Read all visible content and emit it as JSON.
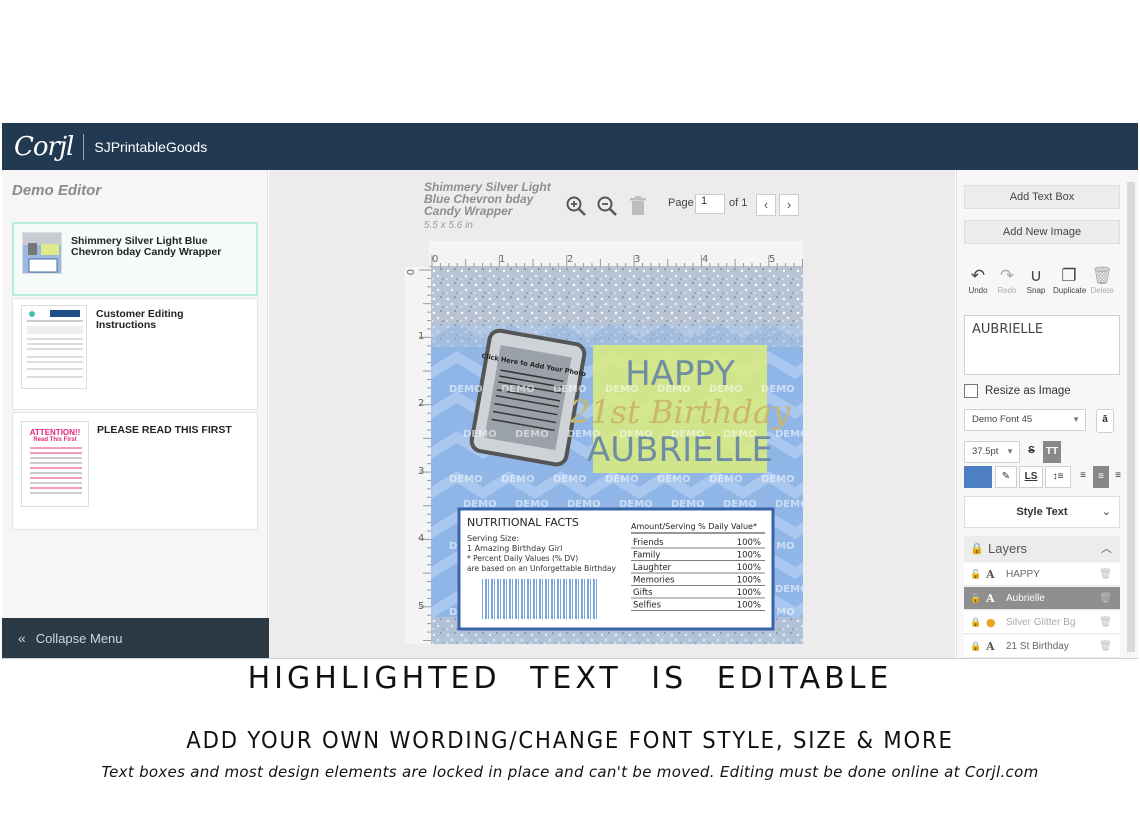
{
  "topbar": {
    "logo": "Corjl",
    "shop_name": "SJPrintableGoods"
  },
  "left_panel": {
    "title": "Demo Editor",
    "items": [
      {
        "label": "Shimmery Silver Light Blue Chevron bday Candy Wrapper",
        "active": true
      },
      {
        "label": "Customer Editing Instructions",
        "active": false
      },
      {
        "label": "PLEASE READ THIS FIRST",
        "active": false,
        "thumb_heading": "ATTENTION!!",
        "thumb_sub": "Read This First"
      }
    ],
    "collapse_label": "Collapse Menu"
  },
  "document": {
    "title": "Shimmery Silver Light Blue Chevron bday Candy Wrapper",
    "size": "5.5 x 5.6 in",
    "page_label": "Page",
    "page_value": "1",
    "of_label": "of 1",
    "ruler_top": [
      "0",
      "1",
      "2",
      "3",
      "4",
      "5"
    ],
    "ruler_left": [
      "0",
      "1",
      "2",
      "3",
      "4",
      "5"
    ]
  },
  "design": {
    "watermark": "DEMO",
    "frame_text": "Click Here to Add Your Photo",
    "line1": "HAPPY",
    "line2": "21st Birthday",
    "line3": "AUBRIELLE",
    "nutrition": {
      "heading": "NUTRITIONAL FACTS",
      "serving_label": "Serving Size:",
      "serving_value": "1 Amazing Birthday Girl",
      "dv_note": "* Percent Daily Values (% DV)",
      "dv_note2": "are based on an Unforgettable Birthday",
      "table_header": "Amount/Serving % Daily Value*",
      "rows": [
        {
          "name": "Friends",
          "value": "100%"
        },
        {
          "name": "Family",
          "value": "100%"
        },
        {
          "name": "Laughter",
          "value": "100%"
        },
        {
          "name": "Memories",
          "value": "100%"
        },
        {
          "name": "Gifts",
          "value": "100%"
        },
        {
          "name": "Selfies",
          "value": "100%"
        }
      ]
    }
  },
  "right_panel": {
    "add_text_box": "Add Text Box",
    "add_new_image": "Add New Image",
    "tools": [
      {
        "label": "Undo",
        "icon": "undo-icon"
      },
      {
        "label": "Redo",
        "icon": "redo-icon"
      },
      {
        "label": "Snap",
        "icon": "magnet-icon"
      },
      {
        "label": "Duplicate",
        "icon": "duplicate-icon"
      },
      {
        "label": "Delete",
        "icon": "trash-icon"
      }
    ],
    "text_value": "AUBRIELLE",
    "resize_as_image": "Resize as Image",
    "font_select": "Demo Font 45",
    "font_size": "37.5pt",
    "text_color": "#4e7fc0",
    "style_text": "Style Text",
    "layers_title": "Layers",
    "layers": [
      {
        "name": "HAPPY",
        "type": "A",
        "selected": false
      },
      {
        "name": "Aubrielle",
        "type": "A",
        "selected": true
      },
      {
        "name": "Silver Glitter Bg",
        "type": "image",
        "selected": false
      },
      {
        "name": "21 St Birthday",
        "type": "A",
        "selected": false
      }
    ]
  },
  "banner": {
    "line1": "HIGHLIGHTED TEXT IS EDITABLE",
    "line2": "ADD YOUR OWN WORDING/CHANGE FONT STYLE, SIZE & MORE",
    "line3": "Text boxes and most design elements are locked in place and can't be moved. Editing must be done online at Corjl.com"
  }
}
